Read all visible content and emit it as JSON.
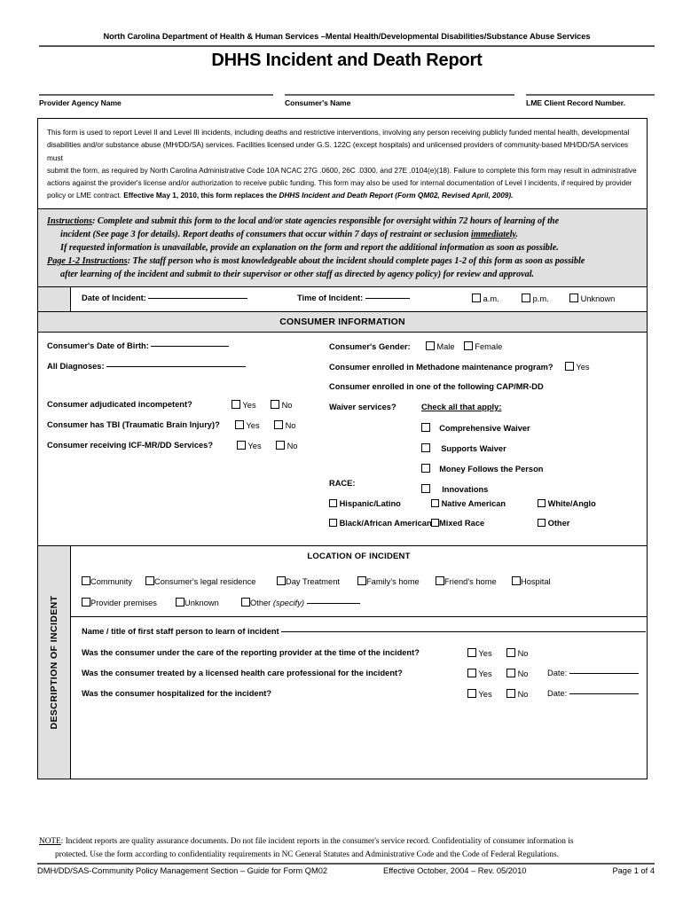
{
  "header": {
    "agency_line": "North Carolina Department of Health & Human Services –Mental Health/Developmental Disabilities/Substance Abuse Services",
    "title": "DHHS Incident and Death Report"
  },
  "signature_lines": [
    {
      "label": "Provider Agency Name"
    },
    {
      "label": "Consumer's Name"
    },
    {
      "label": "LME Client Record Number."
    }
  ],
  "intro": {
    "line1": "This form is used to report Level II and Level III incidents, including deaths and restrictive interventions, involving any person receiving publicly funded mental health, developmental",
    "line2": "disabilities and/or substance abuse (MH/DD/SA) services.  Facilities licensed under G.S. 122C (except hospitals) and unlicensed providers of community-based MH/DD/SA services must",
    "line3": "submit the form, as required by North Carolina Administrative Code 10A NCAC 27G .0600, 26C .0300, and 27E .0104(e)(18).  Failure to complete this form may result in administrative",
    "line4": "actions against the provider's license and/or authorization to receive public funding.  This form may also be used for internal documentation of Level I incidents, if required by provider",
    "line5_plain": "policy or LME contract.   ",
    "line5_bold": "Effective May 1, 2010, this form replaces the ",
    "line5_bold_italic": "DHHS Incident and Death Report (Form QM02, Revised April, 2009)."
  },
  "instructions": {
    "label1": "Instructions",
    "line1": ":  Complete and submit this form to the local and/or state agencies responsible for oversight within 72 hours of learning of the",
    "line2a": "incident (See page 3 for details).  Report deaths of consumers that occur within 7 days of restraint or seclusion ",
    "line2b": "immediately",
    "line2c": ".",
    "line3": "If requested information is unavailable, provide an explanation on the form and report the additional information as soon as possible.",
    "label2": "Page 1-2 Instructions",
    "line4": ":  The staff person who is most knowledgeable about the incident should complete pages 1-2 of this form as soon as possible",
    "line5": "after learning of the incident and submit to their supervisor or other staff as directed by agency policy) for review and approval."
  },
  "incident_row": {
    "date_label": "Date of Incident:",
    "time_label": "Time of Incident:",
    "am_label": "a.m.",
    "pm_label": "p.m.",
    "unknown_label": "Unknown"
  },
  "consumer_section": {
    "band_title": "CONSUMER INFORMATION",
    "dob_label": "Consumer's Date of Birth:",
    "diagnoses_label": "All Diagnoses:",
    "q_adjudicated": "Consumer adjudicated incompetent?",
    "q_tbi": "Consumer has TBI (Traumatic Brain Injury)?",
    "q_icfmr": "Consumer receiving ICF-MR/DD Services?",
    "yes_label": "Yes",
    "no_label": "No",
    "gender_label": "Consumer's Gender",
    "male_label": "Male",
    "female_label": "Female",
    "methadone_label": "Consumer enrolled in Methadone maintenance program?",
    "methadone_yes": "Yes",
    "cap_line1": "Consumer enrolled in one of the following CAP/MR-DD",
    "cap_line2": "Waiver services?",
    "check_all": "Check all that apply:",
    "waivers": [
      "Comprehensive Waiver",
      "Supports Waiver",
      "Money Follows the Person",
      "Innovations"
    ],
    "race_label": "RACE:",
    "race_options": [
      "Hispanic/Latino",
      "Native American",
      "White/Anglo",
      "Black/African American",
      "Mixed Race",
      "Other"
    ]
  },
  "description_section": {
    "stub_label": "DESCRIPTION OF INCIDENT",
    "location_title": "LOCATION OF INCIDENT",
    "location_row1": [
      "Community",
      "Consumer's legal residence",
      "Day Treatment",
      "Family's home",
      "Friend's home",
      "Hospital"
    ],
    "location_row2": [
      "Provider premises",
      "Unknown"
    ],
    "other_label": "Other",
    "other_specify": "(specify)",
    "staff_name_label": "Name / title of first staff person to learn of incident",
    "q1": "Was the consumer under the care of the reporting provider at the time of the incident?",
    "q2": "Was the consumer treated by a licensed health care professional for the incident?",
    "q3": "Was the consumer hospitalized for the incident?",
    "yes_label": "Yes",
    "no_label": "No",
    "date_label": "Date:"
  },
  "note": {
    "label": "NOTE",
    "line1": ": Incident reports are quality assurance documents. Do not file incident reports in the consumer's service record. Confidentiality of consumer information is",
    "line2": "protected. Use the form according to confidentiality requirements in NC General Statutes and Administrative Code and the Code of Federal Regulations."
  },
  "footer": {
    "left": "DMH/DD/SAS-Community Policy Management Section – Guide for Form QM02",
    "center": "Effective October, 2004 – Rev. 05/2010",
    "right": "Page 1 of 4"
  }
}
